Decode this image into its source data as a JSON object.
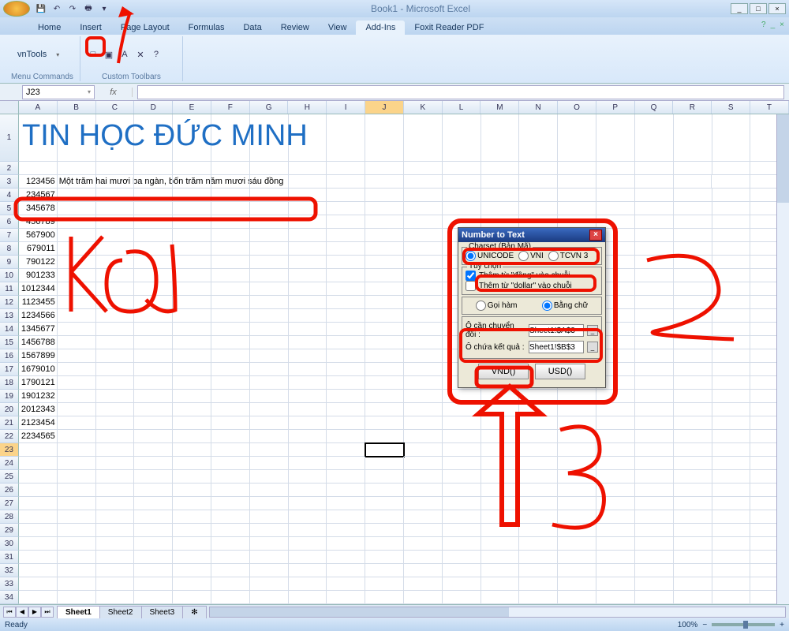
{
  "window": {
    "title": "Book1 - Microsoft Excel"
  },
  "ribbon": {
    "tabs": [
      "Home",
      "Insert",
      "Page Layout",
      "Formulas",
      "Data",
      "Review",
      "View",
      "Add-Ins",
      "Foxit Reader PDF"
    ],
    "active_index": 7,
    "group1": {
      "btn": "vnTools",
      "label": "Menu Commands"
    },
    "group2": {
      "label": "Custom Toolbars"
    }
  },
  "namebox": "J23",
  "columns": [
    "A",
    "B",
    "C",
    "D",
    "E",
    "F",
    "G",
    "H",
    "I",
    "J",
    "K",
    "L",
    "M",
    "N",
    "O",
    "P",
    "Q",
    "R",
    "S",
    "T"
  ],
  "title_cell": "TIN HỌC ĐỨC MINH",
  "rows": {
    "3": {
      "A": "123456",
      "B": "Một trăm hai mươi ba ngàn, bốn trăm năm mươi sáu đồng"
    },
    "4": {
      "A": "234567"
    },
    "5": {
      "A": "345678"
    },
    "6": {
      "A": "456789"
    },
    "7": {
      "A": "567900"
    },
    "8": {
      "A": "679011"
    },
    "9": {
      "A": "790122"
    },
    "10": {
      "A": "901233"
    },
    "11": {
      "A": "1012344"
    },
    "12": {
      "A": "1123455"
    },
    "13": {
      "A": "1234566"
    },
    "14": {
      "A": "1345677"
    },
    "15": {
      "A": "1456788"
    },
    "16": {
      "A": "1567899"
    },
    "17": {
      "A": "1679010"
    },
    "18": {
      "A": "1790121"
    },
    "19": {
      "A": "1901232"
    },
    "20": {
      "A": "2012343"
    },
    "21": {
      "A": "2123454"
    },
    "22": {
      "A": "2234565"
    }
  },
  "active_cell": "J23",
  "dialog": {
    "title": "Number to Text",
    "charset_label": "Charset (Bản Mã)",
    "charsets": [
      "UNICODE",
      "VNI",
      "TCVN 3"
    ],
    "charset_selected": "UNICODE",
    "options_label": "Tùy chọn",
    "opt_dong": "Thêm từ \"đồng\" vào chuỗi",
    "opt_dong_checked": true,
    "opt_dollar": "Thêm từ \"dollar\" vào chuỗi",
    "opt_dollar_checked": false,
    "mode_call": "Gọi hàm",
    "mode_text": "Bằng chữ",
    "mode_selected": "Bằng chữ",
    "src_label": "Ô cần chuyển đổi :",
    "src_value": "Sheet1!$A$3",
    "dst_label": "Ô chứa kết quả :",
    "dst_value": "Sheet1!$B$3",
    "btn_vnd": "VND()",
    "btn_usd": "USD()"
  },
  "sheet_tabs": [
    "Sheet1",
    "Sheet2",
    "Sheet3"
  ],
  "active_sheet": 0,
  "status": "Ready",
  "zoom": "100%",
  "annotations": {
    "kq": "KQ",
    "n1": "1",
    "n2": "2",
    "n3": "3"
  }
}
